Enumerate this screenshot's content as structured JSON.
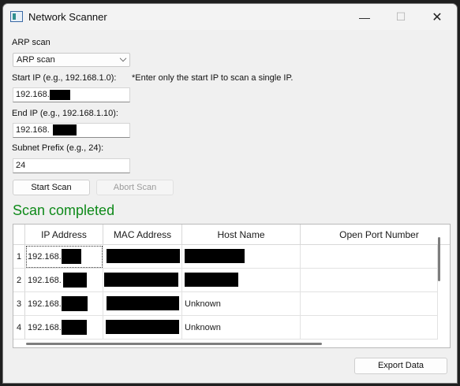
{
  "window": {
    "title": "Network Scanner",
    "minimize": "—",
    "maximize": "☐",
    "close": "✕"
  },
  "scan_type": {
    "label": "ARP scan",
    "selected": "ARP scan"
  },
  "start_ip": {
    "label": "Start IP (e.g., 192.168.1.0):",
    "hint": "*Enter only the start IP to scan a single IP.",
    "value_prefix": "192.168."
  },
  "end_ip": {
    "label": "End IP (e.g., 192.168.1.10):",
    "value_prefix": "192.168."
  },
  "subnet": {
    "label": "Subnet Prefix (e.g., 24):",
    "value": "24"
  },
  "buttons": {
    "start": "Start Scan",
    "abort": "Abort Scan",
    "export": "Export Data"
  },
  "status": {
    "text": "Scan completed",
    "color": "#0f8a1a"
  },
  "table": {
    "headers": [
      "IP Address",
      "MAC Address",
      "Host Name",
      "Open Port Number"
    ],
    "rows": [
      {
        "num": "1",
        "ip": "192.168.",
        "host": ""
      },
      {
        "num": "2",
        "ip": "192.168.",
        "host": ""
      },
      {
        "num": "3",
        "ip": "192.168.",
        "host": "Unknown"
      },
      {
        "num": "4",
        "ip": "192.168.",
        "host": "Unknown"
      }
    ]
  }
}
